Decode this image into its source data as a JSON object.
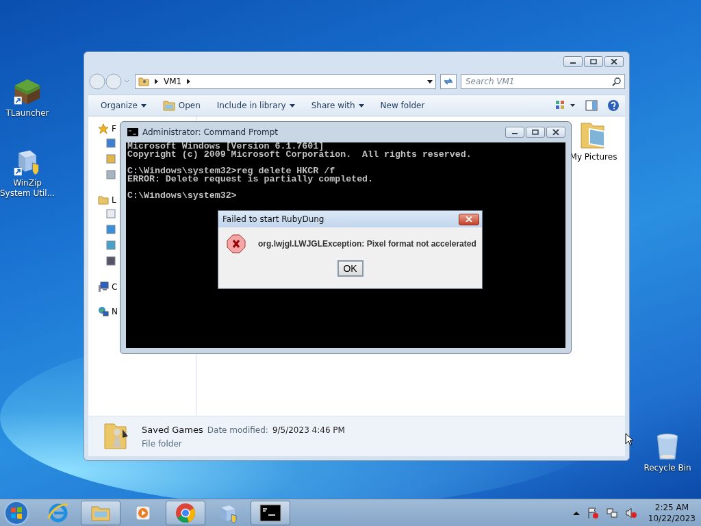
{
  "desktop_icons": [
    {
      "label": "TLauncher",
      "kind": "grass"
    },
    {
      "label": "WinZip\nSystem Util...",
      "kind": "winzip"
    },
    {
      "label": "Recycle Bin",
      "kind": "bin"
    }
  ],
  "explorer": {
    "address": [
      "VM1"
    ],
    "search": {
      "placeholder": "Search VM1"
    },
    "toolbar": [
      {
        "label": "Organize",
        "dropdown": true,
        "icon": false
      },
      {
        "label": "Open",
        "dropdown": false,
        "icon": true
      },
      {
        "label": "Include in library",
        "dropdown": true,
        "icon": false
      },
      {
        "label": "Share with",
        "dropdown": true,
        "icon": false
      },
      {
        "label": "New folder",
        "dropdown": false,
        "icon": false
      }
    ],
    "nav_groups": [
      {
        "label": "F",
        "kind": "star"
      },
      {
        "label": "L",
        "kind": "library"
      },
      {
        "label": "C",
        "kind": "computer"
      },
      {
        "label": "N",
        "kind": "network"
      }
    ],
    "items": [
      {
        "label": "My Pictures"
      }
    ],
    "details": {
      "name": "Saved Games",
      "date_label": "Date modified:",
      "date": "9/5/2023 4:46 PM",
      "type": "File folder"
    }
  },
  "cmd": {
    "title": "Administrator:  Command Prompt",
    "blocks": [
      [
        "Microsoft Windows [Version 6.1.7601]",
        "Copyright (c) 2009 Microsoft Corporation.  All rights reserved."
      ],
      [
        "C:\\Windows\\system32>reg delete HKCR /f",
        "ERROR: Delete request is partially completed."
      ],
      [
        "C:\\Windows\\system32>"
      ]
    ]
  },
  "dialog": {
    "title": "Failed to start RubyDung",
    "message": "org.lwjgl.LWJGLException: Pixel format not accelerated",
    "button": "OK"
  },
  "taskbar": {
    "items": [
      {
        "kind": "ie",
        "open": false
      },
      {
        "kind": "explorer",
        "open": true
      },
      {
        "kind": "media",
        "open": false
      },
      {
        "kind": "chrome",
        "open": true
      },
      {
        "kind": "winzip",
        "open": false
      },
      {
        "kind": "cmd",
        "open": true
      }
    ],
    "time": "2:25 AM",
    "date": "10/22/2023"
  }
}
